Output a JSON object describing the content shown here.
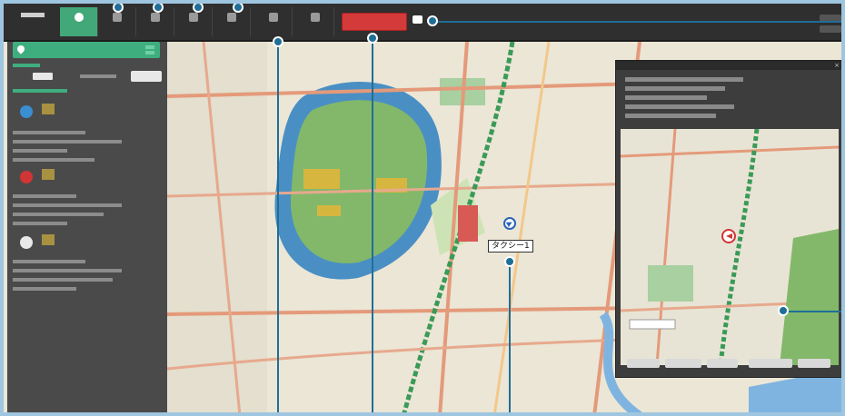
{
  "toolbar": {
    "logo_text": "",
    "buttons": [
      {
        "label": ""
      },
      {
        "label": ""
      },
      {
        "label": ""
      },
      {
        "label": ""
      },
      {
        "label": ""
      },
      {
        "label": ""
      },
      {
        "label": ""
      }
    ],
    "red_button_label": "",
    "top_right": [
      "",
      ""
    ]
  },
  "panel": {
    "header": "",
    "select_button": ""
  },
  "map": {
    "taxi_label": "タクシー1"
  },
  "popup": {
    "title": "",
    "buttons": [
      "",
      "",
      "",
      "",
      ""
    ]
  },
  "icons": {
    "taxi_marker": "navigation-arrow-icon",
    "popup_marker": "navigation-arrow-icon",
    "chat": "chat-bubble-icon"
  },
  "colors": {
    "toolbar_bg": "#2f2f2f",
    "active_tab": "#43a879",
    "alert_button": "#d43a3a",
    "annotation": "#1f6e97",
    "frame": "#9fc6e0"
  }
}
